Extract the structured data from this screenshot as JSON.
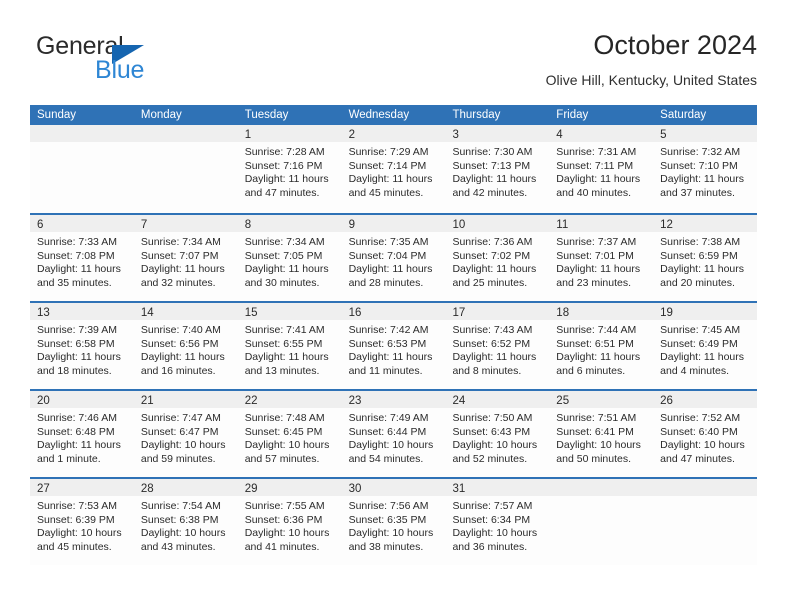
{
  "logo": {
    "word_top": "General",
    "word_bottom": "Blue",
    "triangle_icon": "triangle-icon",
    "color_dark": "#2b2b2b",
    "color_blue": "#2e86d4",
    "color_triangle": "#1565b0"
  },
  "header": {
    "title": "October 2024",
    "subtitle": "Olive Hill, Kentucky, United States"
  },
  "colors": {
    "header_blue": "#2f72b6",
    "row_divider_blue": "#2f72b6",
    "daynum_band": "#efefef",
    "cell_background": "#fdfdfd",
    "text": "#2b2b2b"
  },
  "weekday_headers": [
    "Sunday",
    "Monday",
    "Tuesday",
    "Wednesday",
    "Thursday",
    "Friday",
    "Saturday"
  ],
  "weeks": [
    [
      {
        "day": "",
        "empty": true,
        "lines": []
      },
      {
        "day": "",
        "empty": true,
        "lines": []
      },
      {
        "day": "1",
        "empty": false,
        "lines": [
          "Sunrise: 7:28 AM",
          "Sunset: 7:16 PM",
          "Daylight: 11 hours",
          "and 47 minutes."
        ]
      },
      {
        "day": "2",
        "empty": false,
        "lines": [
          "Sunrise: 7:29 AM",
          "Sunset: 7:14 PM",
          "Daylight: 11 hours",
          "and 45 minutes."
        ]
      },
      {
        "day": "3",
        "empty": false,
        "lines": [
          "Sunrise: 7:30 AM",
          "Sunset: 7:13 PM",
          "Daylight: 11 hours",
          "and 42 minutes."
        ]
      },
      {
        "day": "4",
        "empty": false,
        "lines": [
          "Sunrise: 7:31 AM",
          "Sunset: 7:11 PM",
          "Daylight: 11 hours",
          "and 40 minutes."
        ]
      },
      {
        "day": "5",
        "empty": false,
        "lines": [
          "Sunrise: 7:32 AM",
          "Sunset: 7:10 PM",
          "Daylight: 11 hours",
          "and 37 minutes."
        ]
      }
    ],
    [
      {
        "day": "6",
        "empty": false,
        "lines": [
          "Sunrise: 7:33 AM",
          "Sunset: 7:08 PM",
          "Daylight: 11 hours",
          "and 35 minutes."
        ]
      },
      {
        "day": "7",
        "empty": false,
        "lines": [
          "Sunrise: 7:34 AM",
          "Sunset: 7:07 PM",
          "Daylight: 11 hours",
          "and 32 minutes."
        ]
      },
      {
        "day": "8",
        "empty": false,
        "lines": [
          "Sunrise: 7:34 AM",
          "Sunset: 7:05 PM",
          "Daylight: 11 hours",
          "and 30 minutes."
        ]
      },
      {
        "day": "9",
        "empty": false,
        "lines": [
          "Sunrise: 7:35 AM",
          "Sunset: 7:04 PM",
          "Daylight: 11 hours",
          "and 28 minutes."
        ]
      },
      {
        "day": "10",
        "empty": false,
        "lines": [
          "Sunrise: 7:36 AM",
          "Sunset: 7:02 PM",
          "Daylight: 11 hours",
          "and 25 minutes."
        ]
      },
      {
        "day": "11",
        "empty": false,
        "lines": [
          "Sunrise: 7:37 AM",
          "Sunset: 7:01 PM",
          "Daylight: 11 hours",
          "and 23 minutes."
        ]
      },
      {
        "day": "12",
        "empty": false,
        "lines": [
          "Sunrise: 7:38 AM",
          "Sunset: 6:59 PM",
          "Daylight: 11 hours",
          "and 20 minutes."
        ]
      }
    ],
    [
      {
        "day": "13",
        "empty": false,
        "lines": [
          "Sunrise: 7:39 AM",
          "Sunset: 6:58 PM",
          "Daylight: 11 hours",
          "and 18 minutes."
        ]
      },
      {
        "day": "14",
        "empty": false,
        "lines": [
          "Sunrise: 7:40 AM",
          "Sunset: 6:56 PM",
          "Daylight: 11 hours",
          "and 16 minutes."
        ]
      },
      {
        "day": "15",
        "empty": false,
        "lines": [
          "Sunrise: 7:41 AM",
          "Sunset: 6:55 PM",
          "Daylight: 11 hours",
          "and 13 minutes."
        ]
      },
      {
        "day": "16",
        "empty": false,
        "lines": [
          "Sunrise: 7:42 AM",
          "Sunset: 6:53 PM",
          "Daylight: 11 hours",
          "and 11 minutes."
        ]
      },
      {
        "day": "17",
        "empty": false,
        "lines": [
          "Sunrise: 7:43 AM",
          "Sunset: 6:52 PM",
          "Daylight: 11 hours",
          "and 8 minutes."
        ]
      },
      {
        "day": "18",
        "empty": false,
        "lines": [
          "Sunrise: 7:44 AM",
          "Sunset: 6:51 PM",
          "Daylight: 11 hours",
          "and 6 minutes."
        ]
      },
      {
        "day": "19",
        "empty": false,
        "lines": [
          "Sunrise: 7:45 AM",
          "Sunset: 6:49 PM",
          "Daylight: 11 hours",
          "and 4 minutes."
        ]
      }
    ],
    [
      {
        "day": "20",
        "empty": false,
        "lines": [
          "Sunrise: 7:46 AM",
          "Sunset: 6:48 PM",
          "Daylight: 11 hours",
          "and 1 minute."
        ]
      },
      {
        "day": "21",
        "empty": false,
        "lines": [
          "Sunrise: 7:47 AM",
          "Sunset: 6:47 PM",
          "Daylight: 10 hours",
          "and 59 minutes."
        ]
      },
      {
        "day": "22",
        "empty": false,
        "lines": [
          "Sunrise: 7:48 AM",
          "Sunset: 6:45 PM",
          "Daylight: 10 hours",
          "and 57 minutes."
        ]
      },
      {
        "day": "23",
        "empty": false,
        "lines": [
          "Sunrise: 7:49 AM",
          "Sunset: 6:44 PM",
          "Daylight: 10 hours",
          "and 54 minutes."
        ]
      },
      {
        "day": "24",
        "empty": false,
        "lines": [
          "Sunrise: 7:50 AM",
          "Sunset: 6:43 PM",
          "Daylight: 10 hours",
          "and 52 minutes."
        ]
      },
      {
        "day": "25",
        "empty": false,
        "lines": [
          "Sunrise: 7:51 AM",
          "Sunset: 6:41 PM",
          "Daylight: 10 hours",
          "and 50 minutes."
        ]
      },
      {
        "day": "26",
        "empty": false,
        "lines": [
          "Sunrise: 7:52 AM",
          "Sunset: 6:40 PM",
          "Daylight: 10 hours",
          "and 47 minutes."
        ]
      }
    ],
    [
      {
        "day": "27",
        "empty": false,
        "lines": [
          "Sunrise: 7:53 AM",
          "Sunset: 6:39 PM",
          "Daylight: 10 hours",
          "and 45 minutes."
        ]
      },
      {
        "day": "28",
        "empty": false,
        "lines": [
          "Sunrise: 7:54 AM",
          "Sunset: 6:38 PM",
          "Daylight: 10 hours",
          "and 43 minutes."
        ]
      },
      {
        "day": "29",
        "empty": false,
        "lines": [
          "Sunrise: 7:55 AM",
          "Sunset: 6:36 PM",
          "Daylight: 10 hours",
          "and 41 minutes."
        ]
      },
      {
        "day": "30",
        "empty": false,
        "lines": [
          "Sunrise: 7:56 AM",
          "Sunset: 6:35 PM",
          "Daylight: 10 hours",
          "and 38 minutes."
        ]
      },
      {
        "day": "31",
        "empty": false,
        "lines": [
          "Sunrise: 7:57 AM",
          "Sunset: 6:34 PM",
          "Daylight: 10 hours",
          "and 36 minutes."
        ]
      },
      {
        "day": "",
        "empty": true,
        "lines": []
      },
      {
        "day": "",
        "empty": true,
        "lines": []
      }
    ]
  ]
}
